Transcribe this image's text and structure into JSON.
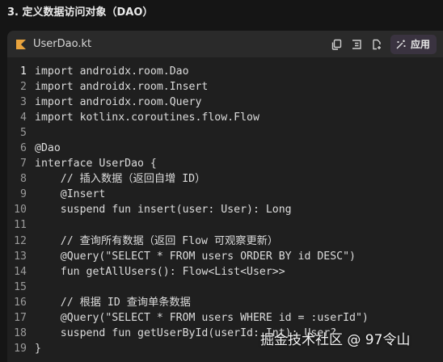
{
  "heading": "3. 定义数据访问对象（DAO）",
  "file": {
    "name": "UserDao.kt",
    "icon": "kotlin-file-icon",
    "icon_color": "#e8a33d"
  },
  "toolbar": {
    "copy_icon": "copy-icon",
    "insert_icon": "insert-icon",
    "new_file_icon": "new-file-icon",
    "apply_icon": "magic-wand-icon",
    "apply_label": "应用",
    "apply_bg": "#3a3340"
  },
  "code": {
    "active_line": 1,
    "lines": [
      {
        "n": "1",
        "text": "import androidx.room.Dao"
      },
      {
        "n": "2",
        "text": "import androidx.room.Insert"
      },
      {
        "n": "3",
        "text": "import androidx.room.Query"
      },
      {
        "n": "4",
        "text": "import kotlinx.coroutines.flow.Flow"
      },
      {
        "n": "5",
        "text": ""
      },
      {
        "n": "6",
        "text": "@Dao"
      },
      {
        "n": "7",
        "text": "interface UserDao {"
      },
      {
        "n": "8",
        "text": "    // 插入数据（返回自增 ID）"
      },
      {
        "n": "9",
        "text": "    @Insert"
      },
      {
        "n": "10",
        "text": "    suspend fun insert(user: User): Long"
      },
      {
        "n": "11",
        "text": ""
      },
      {
        "n": "12",
        "text": "    // 查询所有数据（返回 Flow 可观察更新）"
      },
      {
        "n": "13",
        "text": "    @Query(\"SELECT * FROM users ORDER BY id DESC\")"
      },
      {
        "n": "14",
        "text": "    fun getAllUsers(): Flow<List<User>>"
      },
      {
        "n": "15",
        "text": ""
      },
      {
        "n": "16",
        "text": "    // 根据 ID 查询单条数据"
      },
      {
        "n": "17",
        "text": "    @Query(\"SELECT * FROM users WHERE id = :userId\")"
      },
      {
        "n": "18",
        "text": "    suspend fun getUserById(userId: Int): User?"
      },
      {
        "n": "19",
        "text": "}"
      }
    ]
  },
  "watermark": "掘金技术社区 @ 97令山"
}
